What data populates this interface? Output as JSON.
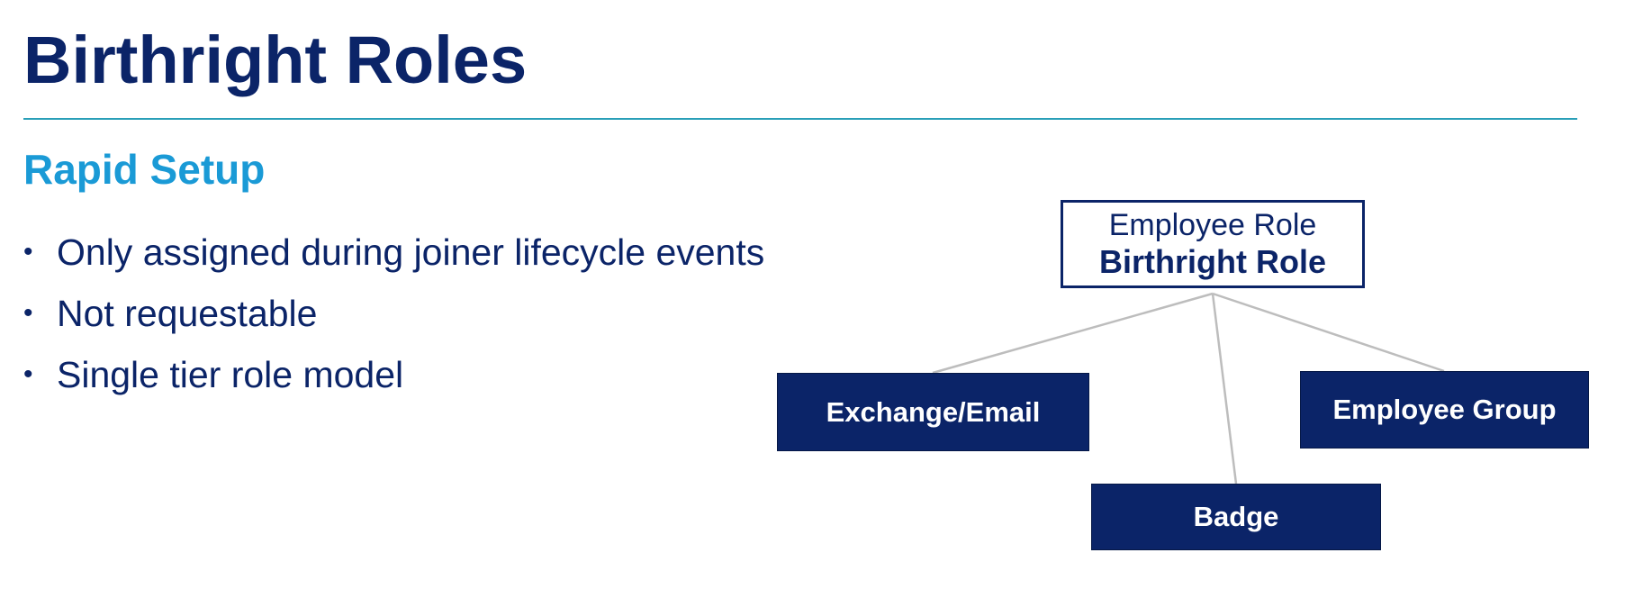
{
  "slide": {
    "title": "Birthright Roles",
    "subtitle": "Rapid Setup",
    "bullets": [
      "Only assigned during joiner lifecycle events",
      "Not requestable",
      "Single tier role model"
    ]
  },
  "diagram": {
    "root": {
      "line1": "Employee Role",
      "line2": "Birthright Role"
    },
    "children": [
      "Exchange/Email",
      "Badge",
      "Employee Group"
    ],
    "colors": {
      "title": "#0b2468",
      "subtitle": "#1a9ad6",
      "rule": "#2a9fb8",
      "box_fill": "#0b2468",
      "connector": "#bdbdbd"
    }
  }
}
